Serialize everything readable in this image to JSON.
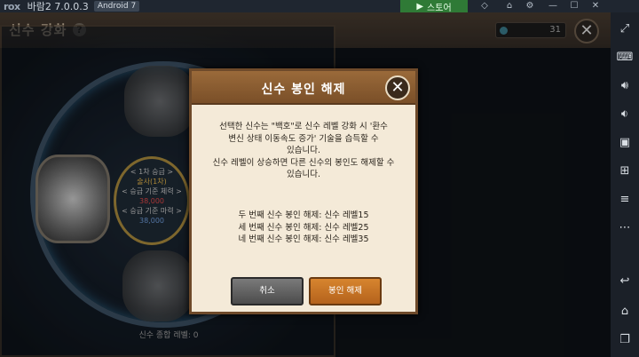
{
  "emulator": {
    "logo": "rox",
    "app_version": "바람2 7.0.0.3",
    "android_badge": "Android 7",
    "store_label": "스토어",
    "icons": [
      "gift-icon",
      "home-icon",
      "settings-icon",
      "minimize-icon",
      "maximize-icon",
      "close-icon"
    ]
  },
  "sidebar": {
    "icons": [
      "fullscreen-icon",
      "keyboard-icon",
      "volume-up-icon",
      "volume-down-icon",
      "screenshot-icon",
      "apk-icon",
      "layers-icon",
      "more-icon",
      "back-icon",
      "home-icon",
      "recent-apps-icon"
    ]
  },
  "game": {
    "title": "신수 강화",
    "help_label": "?",
    "counter_value": "31",
    "close_label": "✕",
    "info": {
      "stage": "< 1차 승급 >",
      "grade": "술사(1차)",
      "physical_label": "< 승급 기준 체력 >",
      "physical_value": "38,000",
      "magic_label": "< 승급 기준 마력 >",
      "magic_value": "38,000"
    },
    "footer": "신수 종합 레벨: 0"
  },
  "dialog": {
    "title": "신수 봉인 해제",
    "close_label": "✕",
    "message1": "선택한 신수는 \"백호\"로 신수 레벨 강화 시 '환수\n변신 상태 이동속도 증가' 기술을 습득할 수\n있습니다.",
    "message2": "신수 레벨이 상승하면 다른 신수의 봉인도 해제할 수\n있습니다.",
    "levels": [
      "두 번째 신수 봉인 해제: 신수 레벨15",
      "세 번째 신수 봉인 해제: 신수 레벨25",
      "네 번째 신수 봉인 해제: 신수 레벨35"
    ],
    "cancel_label": "취소",
    "confirm_label": "봉인 해제"
  },
  "colors": {
    "dialog_bg": "#f4ead8",
    "header_brown": "#8a5c30",
    "confirm_orange": "#c8721f",
    "cancel_gray": "#5e5e5e",
    "store_green": "#2f7a36"
  }
}
